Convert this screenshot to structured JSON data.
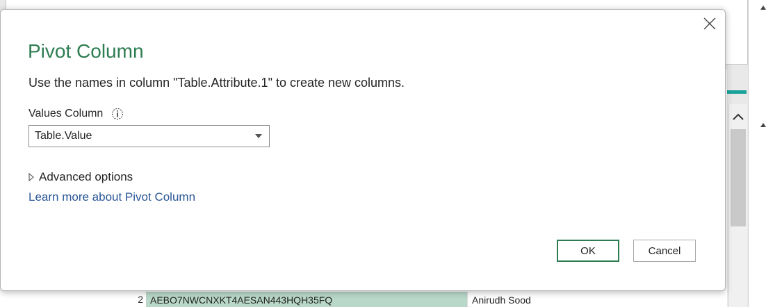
{
  "dialog": {
    "title": "Pivot Column",
    "description": "Use the names in column \"Table.Attribute.1\" to create new columns.",
    "values_column_label": "Values Column",
    "values_column_selected": "Table.Value",
    "advanced_options_label": "Advanced options",
    "learn_more_link": "Learn more about Pivot Column",
    "ok_label": "OK",
    "cancel_label": "Cancel"
  },
  "background_grid": {
    "visible_row": {
      "row_number": "2",
      "id": "AEBO7NWCNXKT4AESAN443HQH35FQ",
      "name": "Anirudh Sood"
    }
  },
  "colors": {
    "title_green": "#2e7d52",
    "link_blue": "#2b5797",
    "ok_border": "#2e7d52",
    "accent_teal": "#1aa39a",
    "grid_selected_cell": "#b9d8c9"
  },
  "icons": {
    "close": "close-icon",
    "info": "info-icon",
    "dropdown": "chevron-down-icon",
    "expand": "caret-right-icon",
    "scroll_up": "chevron-up-icon"
  }
}
